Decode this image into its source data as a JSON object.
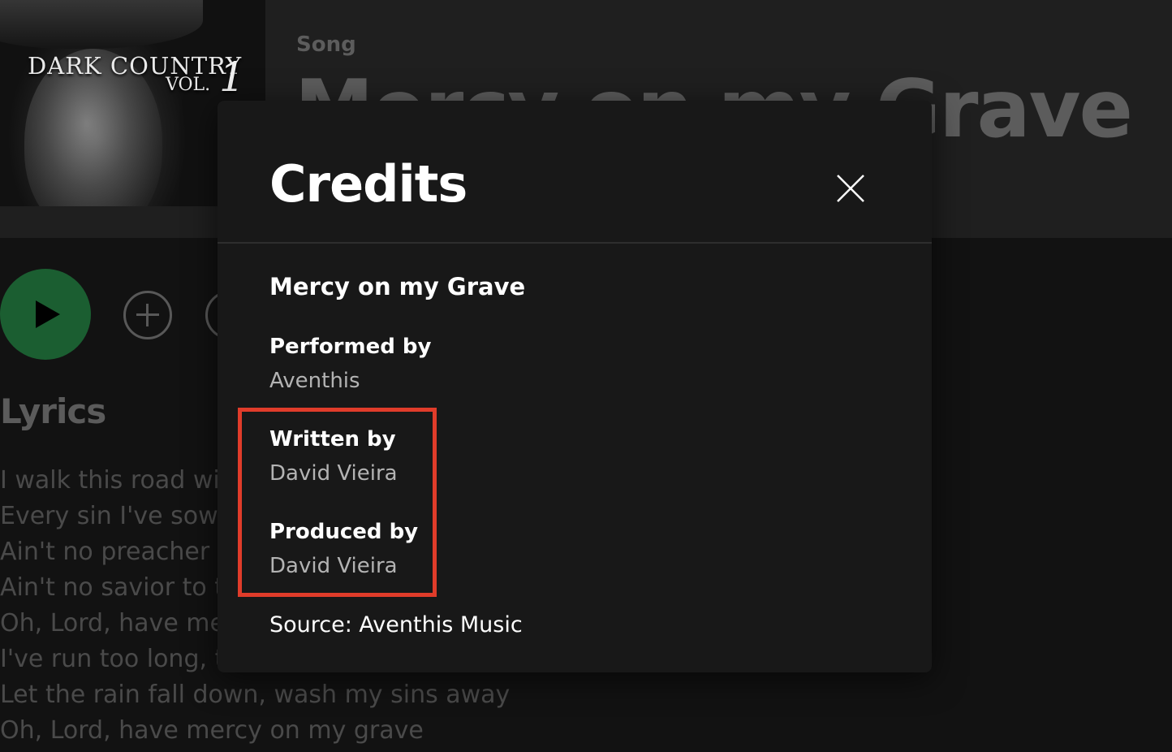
{
  "album": {
    "title_line1": "DARK   COUNTRY",
    "title_vol": "VOL.",
    "title_num": "1"
  },
  "song": {
    "type_label": "Song",
    "title": "Mercy on my Grave"
  },
  "lyrics": {
    "heading": "Lyrics",
    "lines": [
      "I walk this road wit",
      "Every sin I've sown",
      "Ain't no preacher c",
      "Ain't no savior to ta",
      "Oh, Lord, have mer",
      "I've run too long, to",
      "Let the rain fall down, wash my sins away",
      "Oh, Lord, have mercy on my grave"
    ]
  },
  "modal": {
    "title": "Credits",
    "song_title": "Mercy on my Grave",
    "credits": [
      {
        "role": "Performed by",
        "name": "Aventhis"
      },
      {
        "role": "Written by",
        "name": "David Vieira"
      },
      {
        "role": "Produced by",
        "name": "David Vieira"
      }
    ],
    "source": "Source: Aventhis Music"
  },
  "colors": {
    "accent_green": "#1b5e31",
    "highlight_red": "#e03c2a",
    "modal_bg": "#181818"
  },
  "icons": [
    "play-icon",
    "add-icon",
    "close-icon"
  ]
}
